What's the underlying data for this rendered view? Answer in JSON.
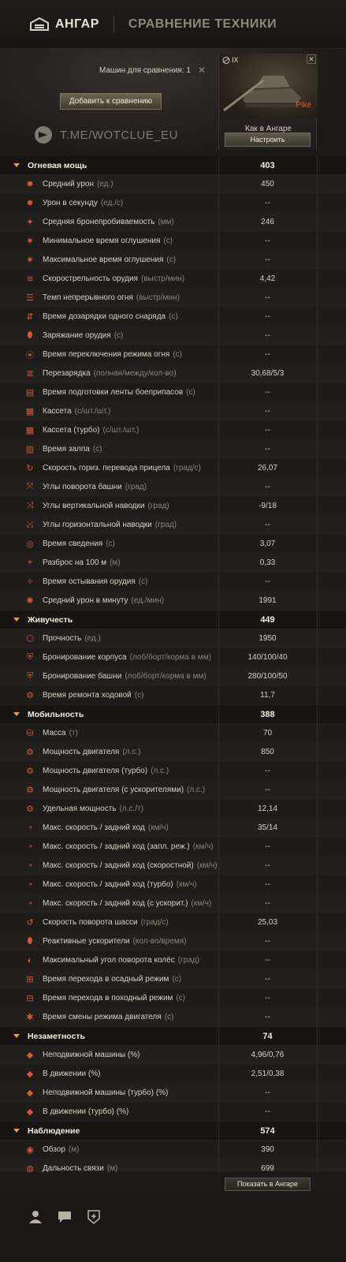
{
  "topbar": {
    "hangar_label": "АНГАР",
    "compare_label": "СРАВНЕНИЕ ТЕХНИКИ"
  },
  "header": {
    "count_label": "Машин для сравнения: 1",
    "add_button": "Добавить к сравнению",
    "watermark": "T.ME/WOTCLUE_EU"
  },
  "tank": {
    "tier": "IX",
    "name": "Pike",
    "state": "Как в Ангаре",
    "setup_button": "Настроить"
  },
  "colors": {
    "accent": "#e6a23c",
    "tank_name": "#e25a36",
    "icon": "#d05a3a"
  },
  "sections": [
    {
      "name": "Огневая мощь",
      "value": "403",
      "rows": [
        {
          "icon": "shell-icon",
          "label": "Средний урон",
          "unit": "(ед.)",
          "value": "450"
        },
        {
          "icon": "fire-icon",
          "label": "Урон в секунду",
          "unit": "(ед./с)",
          "value": "--"
        },
        {
          "icon": "penetration-icon",
          "label": "Средняя бронепробиваемость",
          "unit": "(мм)",
          "value": "246"
        },
        {
          "icon": "stun-icon",
          "label": "Минимальное время оглушения",
          "unit": "(с)",
          "value": "--"
        },
        {
          "icon": "stun-icon",
          "label": "Максимальное время оглушения",
          "unit": "(с)",
          "value": "--"
        },
        {
          "icon": "rate-of-fire-icon",
          "label": "Скорострельность орудия",
          "unit": "(выстр/мин)",
          "value": "4,42"
        },
        {
          "icon": "continuous-fire-icon",
          "label": "Темп непрерывного огня",
          "unit": "(выстр/мин)",
          "value": "--"
        },
        {
          "icon": "autoreload-icon",
          "label": "Время дозарядки одного снаряда",
          "unit": "(с)",
          "value": "--"
        },
        {
          "icon": "charge-icon",
          "label": "Заряжание орудия",
          "unit": "(с)",
          "value": "--"
        },
        {
          "icon": "fire-mode-icon",
          "label": "Время переключения режима огня",
          "unit": "(с)",
          "value": "--"
        },
        {
          "icon": "reload-icon",
          "label": "Перезарядка",
          "unit": "(полная/между/кол-во)",
          "value": "30,68/5/3"
        },
        {
          "icon": "belt-icon",
          "label": "Время подготовки ленты боеприпасов",
          "unit": "(с)",
          "value": "--"
        },
        {
          "icon": "clip-icon",
          "label": "Кассета",
          "unit": "(с/шт./шт.)",
          "value": "--"
        },
        {
          "icon": "clip-turbo-icon",
          "label": "Кассета (турбо)",
          "unit": "(с/шт./шт.)",
          "value": "--"
        },
        {
          "icon": "salvo-icon",
          "label": "Время залпа",
          "unit": "(с)",
          "value": "--"
        },
        {
          "icon": "gun-traverse-icon",
          "label": "Скорость гориз. перевода прицела",
          "unit": "(град/с)",
          "value": "26,07"
        },
        {
          "icon": "turret-angle-icon",
          "label": "Углы поворота башни",
          "unit": "(град)",
          "value": "--"
        },
        {
          "icon": "elevation-icon",
          "label": "Углы вертикальной наводки",
          "unit": "(град)",
          "value": "-9/18"
        },
        {
          "icon": "horizontal-aim-icon",
          "label": "Углы горизонтальной наводки",
          "unit": "(град)",
          "value": "--"
        },
        {
          "icon": "aim-time-icon",
          "label": "Время сведения",
          "unit": "(с)",
          "value": "3,07"
        },
        {
          "icon": "crosshair-icon",
          "label": "Разброс на 100 м",
          "unit": "(м)",
          "value": "0,33"
        },
        {
          "icon": "cooldown-icon",
          "label": "Время остывания орудия",
          "unit": "(с)",
          "value": "--"
        },
        {
          "icon": "dpm-icon",
          "label": "Средний урон в минуту",
          "unit": "(ед./мин)",
          "value": "1991"
        }
      ]
    },
    {
      "name": "Живучесть",
      "value": "449",
      "rows": [
        {
          "icon": "hitpoints-icon",
          "label": "Прочность",
          "unit": "(ед.)",
          "value": "1950"
        },
        {
          "icon": "hull-armor-icon",
          "label": "Бронирование корпуса",
          "unit": "(лоб/борт/корма в мм)",
          "value": "140/100/40"
        },
        {
          "icon": "turret-armor-icon",
          "label": "Бронирование башни",
          "unit": "(лоб/борт/корма в мм)",
          "value": "280/100/50"
        },
        {
          "icon": "repair-icon",
          "label": "Время ремонта ходовой",
          "unit": "(с)",
          "value": "11,7"
        }
      ]
    },
    {
      "name": "Мобильность",
      "value": "388",
      "rows": [
        {
          "icon": "weight-icon",
          "label": "Масса",
          "unit": "(т)",
          "value": "70"
        },
        {
          "icon": "engine-icon",
          "label": "Мощность двигателя",
          "unit": "(л.с.)",
          "value": "850"
        },
        {
          "icon": "engine-turbo-icon",
          "label": "Мощность двигателя (турбо)",
          "unit": "(л.с.)",
          "value": "--"
        },
        {
          "icon": "engine-boost-icon",
          "label": "Мощность двигателя (с ускорителями)",
          "unit": "(л.с.)",
          "value": "--"
        },
        {
          "icon": "power-ratio-icon",
          "label": "Удельная мощность",
          "unit": "(л.с./т)",
          "value": "12,14"
        },
        {
          "icon": "speed-icon",
          "label": "Макс. скорость / задний ход",
          "unit": "(км/ч)",
          "value": "35/14"
        },
        {
          "icon": "speed-siege-icon",
          "label": "Макс. скорость / задний ход (запл. реж.)",
          "unit": "(км/ч)",
          "value": "--"
        },
        {
          "icon": "speed-fast-icon",
          "label": "Макс. скорость / задний ход (скоростной)",
          "unit": "(км/ч)",
          "value": "--"
        },
        {
          "icon": "speed-turbo-icon",
          "label": "Макс. скорость / задний ход (турбо)",
          "unit": "(км/ч)",
          "value": "--"
        },
        {
          "icon": "speed-boost-icon",
          "label": "Макс. скорость / задний ход (с ускорит.)",
          "unit": "(км/ч)",
          "value": "--"
        },
        {
          "icon": "traverse-icon",
          "label": "Скорость поворота шасси",
          "unit": "(град/с)",
          "value": "25,03"
        },
        {
          "icon": "rocket-icon",
          "label": "Реактивные ускорители",
          "unit": "(кол-во/время)",
          "value": "--"
        },
        {
          "icon": "wheel-angle-icon",
          "label": "Максимальный угол поворота колёс",
          "unit": "(град)",
          "value": "--"
        },
        {
          "icon": "siege-mode-icon",
          "label": "Время перехода в осадный режим",
          "unit": "(с)",
          "value": "--"
        },
        {
          "icon": "travel-mode-icon",
          "label": "Время перехода в походный режим",
          "unit": "(с)",
          "value": "--"
        },
        {
          "icon": "engine-mode-icon",
          "label": "Время смены режима двигателя",
          "unit": "(с)",
          "value": "--"
        }
      ]
    },
    {
      "name": "Незаметность",
      "value": "74",
      "rows": [
        {
          "icon": "camo-still-icon",
          "label": "Неподвижной машины (%)",
          "unit": "",
          "value": "4,96/0,76"
        },
        {
          "icon": "camo-moving-icon",
          "label": "В движении (%)",
          "unit": "",
          "value": "2,51/0,38"
        },
        {
          "icon": "camo-still-turbo-icon",
          "label": "Неподвижной машины (турбо) (%)",
          "unit": "",
          "value": "--"
        },
        {
          "icon": "camo-moving-turbo-icon",
          "label": "В движении (турбо) (%)",
          "unit": "",
          "value": "--"
        }
      ]
    },
    {
      "name": "Наблюдение",
      "value": "574",
      "rows": [
        {
          "icon": "view-range-icon",
          "label": "Обзор",
          "unit": "(м)",
          "value": "390"
        },
        {
          "icon": "radio-icon",
          "label": "Дальность связи",
          "unit": "(м)",
          "value": "699"
        }
      ]
    }
  ],
  "footer": {
    "show_button": "Показать в Ангаре"
  }
}
